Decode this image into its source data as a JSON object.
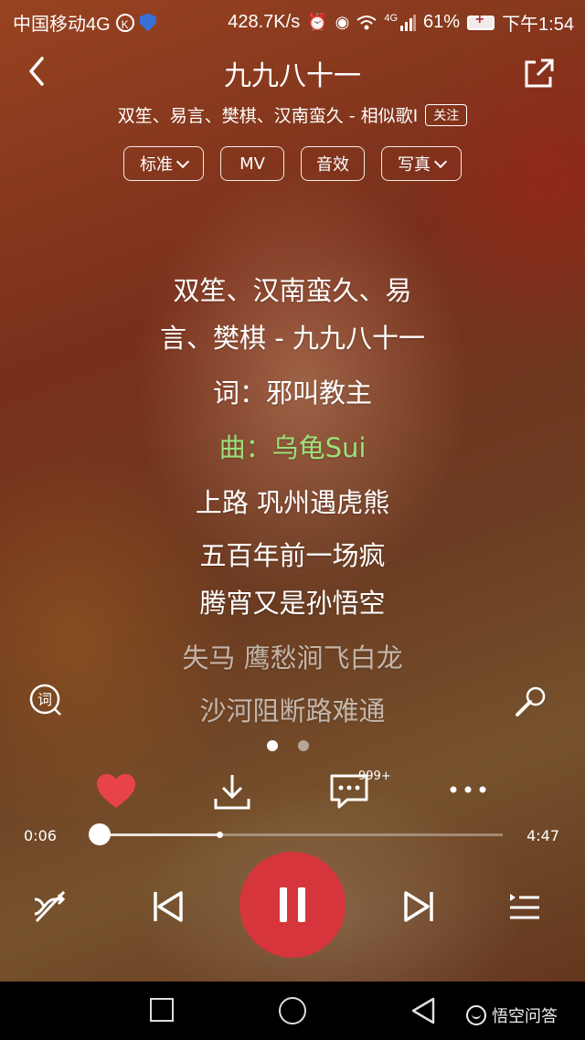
{
  "status_bar": {
    "carrier": "中国移动4G",
    "k_badge": "K",
    "net_speed": "428.7K/s",
    "net_type": "4G",
    "battery": "61%",
    "time": "下午1:54"
  },
  "header": {
    "title": "九九八十一",
    "subtitle": "双笙、易言、樊棋、汉南蛮久 - 相似歌I",
    "follow_label": "关注"
  },
  "options": {
    "quality": "标准",
    "mv": "MV",
    "effects": "音效",
    "photo": "写真"
  },
  "lyrics": [
    "双笙、汉南蛮久、易",
    "言、樊棋 - 九九八十一",
    "词：邪叫教主",
    "曲：乌龟Sui",
    "上路 巩州遇虎熊",
    "五百年前一场疯",
    "腾宵又是孙悟空",
    "失马 鹰愁涧飞白龙",
    "沙河阻断路难通"
  ],
  "lyric_icon_text": "词",
  "actions": {
    "comment_count": "999+"
  },
  "progress": {
    "current": "0:06",
    "total": "4:47",
    "played_fraction": 0.021,
    "buffered_fraction": 0.31
  },
  "watermark": "悟空问答",
  "colors": {
    "accent_red": "#d6363b",
    "heart_red": "#e8434a",
    "active_lyric": "#9be07a"
  },
  "icons": [
    "back-icon",
    "share-icon",
    "lyric-toggle-icon",
    "microphone-icon",
    "heart-icon",
    "download-icon",
    "comment-icon",
    "more-icon",
    "shuffle-off-icon",
    "previous-icon",
    "pause-icon",
    "next-icon",
    "playlist-icon"
  ]
}
